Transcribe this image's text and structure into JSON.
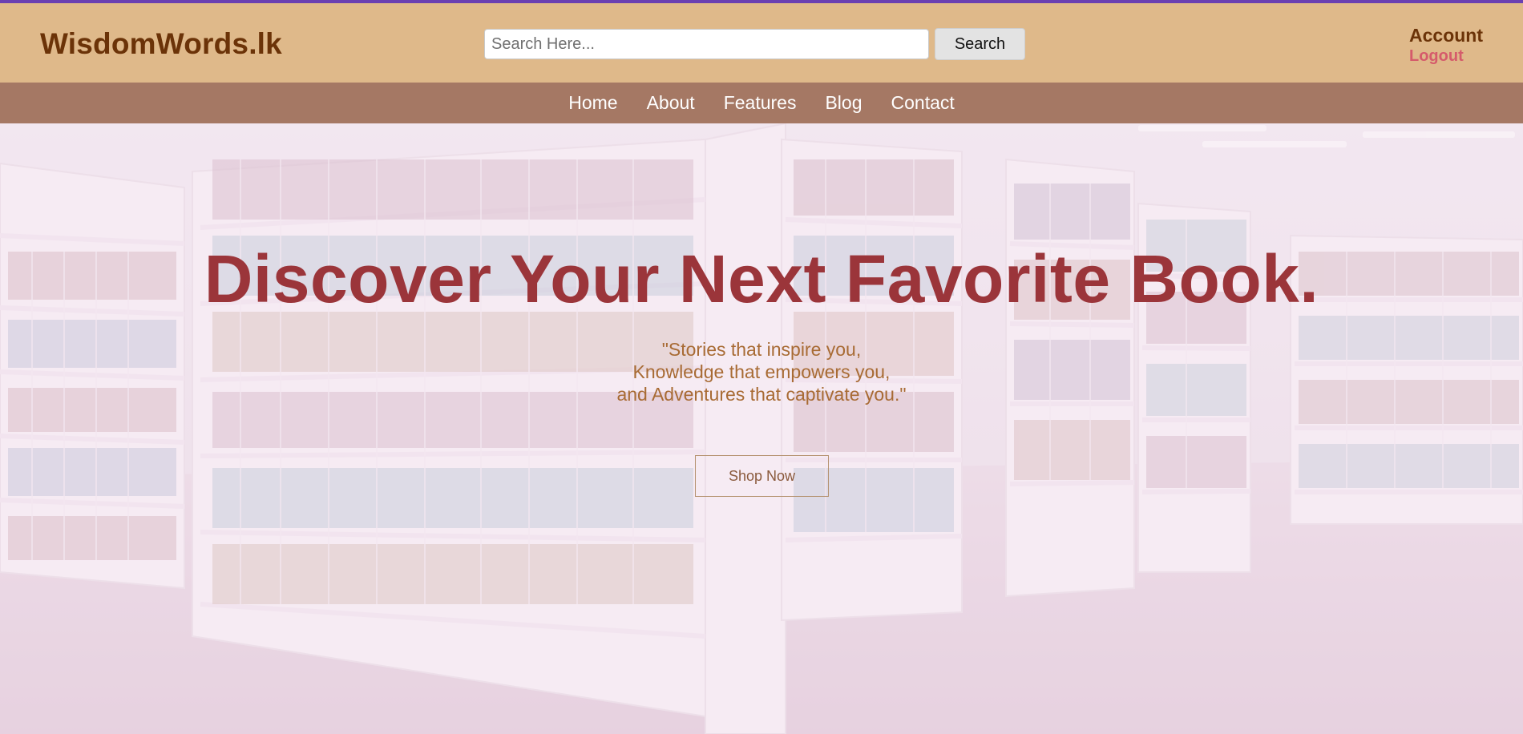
{
  "header": {
    "logo": "WisdomWords.lk",
    "search": {
      "placeholder": "Search Here...",
      "value": "",
      "button_label": "Search"
    },
    "account_label": "Account",
    "logout_label": "Logout"
  },
  "nav": {
    "items": [
      {
        "label": "Home"
      },
      {
        "label": "About"
      },
      {
        "label": "Features"
      },
      {
        "label": "Blog"
      },
      {
        "label": "Contact"
      }
    ]
  },
  "hero": {
    "title": "Discover Your Next Favorite Book.",
    "quote_lines": [
      "\"Stories that inspire you,",
      "Knowledge that empowers you,",
      "and Adventures that captivate you.\""
    ],
    "cta_label": "Shop Now",
    "background": "bookshelf-library-image"
  },
  "colors": {
    "accent_top_border": "#6a3fb2",
    "header_bg": "#dfb98a",
    "nav_bg": "#a57864",
    "logo_text": "#6b3308",
    "logout_text": "#d55b6b",
    "hero_title": "#9b353a",
    "hero_quote": "#a86b34"
  }
}
